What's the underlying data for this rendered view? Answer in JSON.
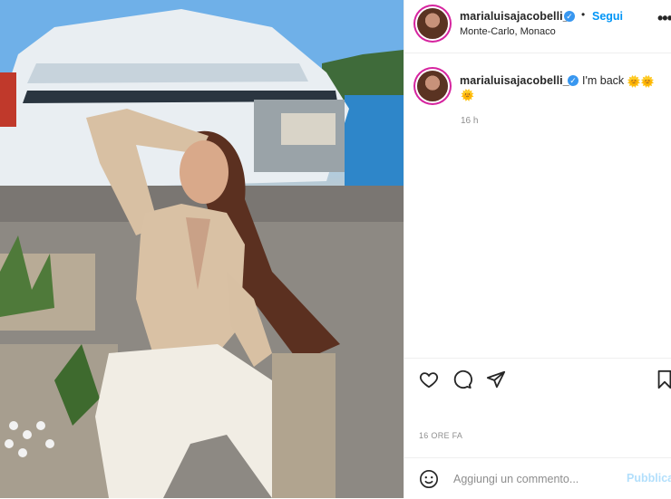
{
  "post": {
    "username": "marialuisajacobelli_",
    "follow_label": "Segui",
    "separator": "•",
    "location": "Monte-Carlo, Monaco",
    "more_label": "•••"
  },
  "comment": {
    "username": "marialuisajacobelli_",
    "caption": "I'm back",
    "sun_emoji": "🌞",
    "time": "16 h"
  },
  "actions": {
    "like_icon": "heart-icon",
    "comment_icon": "comment-icon",
    "share_icon": "share-icon",
    "save_icon": "bookmark-icon"
  },
  "date_label": "16 ORE FA",
  "add_comment": {
    "placeholder": "Aggiungi un commento...",
    "publish_label": "Pubblica"
  },
  "colors": {
    "accent": "#0095f6",
    "verified": "#3897f0",
    "publish_disabled": "#b2dffc"
  }
}
